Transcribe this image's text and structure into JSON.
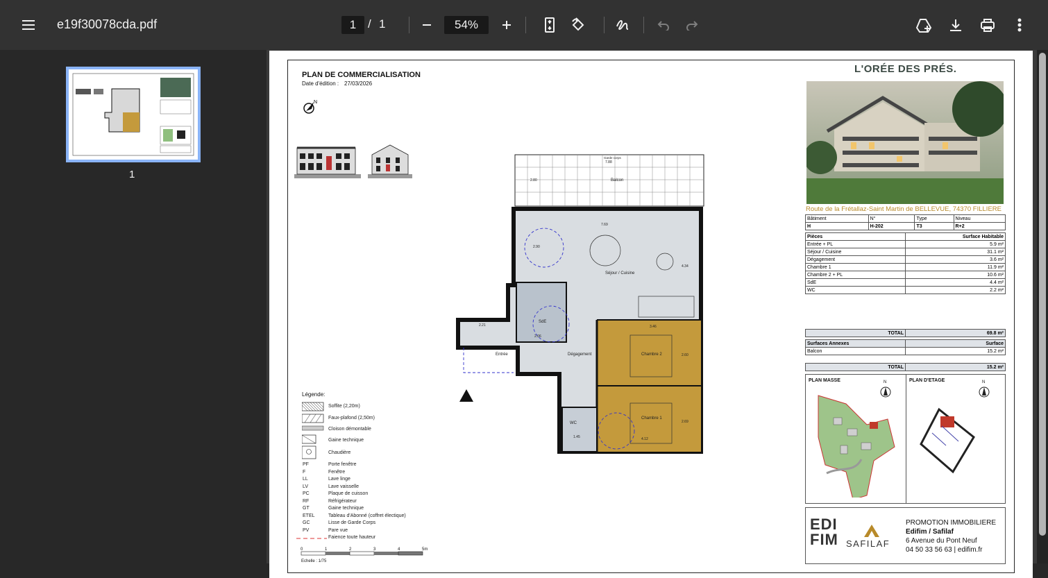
{
  "toolbar": {
    "menu_icon": "menu-icon",
    "filename": "e19f30078cda.pdf",
    "page_current": "1",
    "page_separator": "/",
    "page_total": "1",
    "zoom": "54%"
  },
  "sidebar": {
    "thumb_label": "1"
  },
  "doc": {
    "title": "PLAN DE COMMERCIALISATION",
    "date_label": "Date d'édition :",
    "date_value": "27/03/2026",
    "brand": "L'ORÉE DES PRÉS.",
    "address": "Route de la Frétallaz-Saint Martin de BELLEVUE, 74370 FILLIERE",
    "lot_headers": [
      "Bâtiment",
      "N°",
      "Type",
      "Niveau"
    ],
    "lot_values": [
      "H",
      "H-202",
      "T3",
      "R+2"
    ],
    "rooms_header": [
      "Pièces",
      "Surface Habitable"
    ],
    "rooms": [
      {
        "name": "Entrée + PL",
        "area": "5.9 m²"
      },
      {
        "name": "Séjour / Cuisine",
        "area": "31.1 m²"
      },
      {
        "name": "Dégagement",
        "area": "3.6 m²"
      },
      {
        "name": "Chambre 1",
        "area": "11.9 m²"
      },
      {
        "name": "Chambre 2 + PL",
        "area": "10.6 m²"
      },
      {
        "name": "SdE",
        "area": "4.4 m²"
      },
      {
        "name": "WC",
        "area": "2.2 m²"
      }
    ],
    "total_label": "TOTAL",
    "total_value": "69.8 m²",
    "annex_header": [
      "Surfaces Annexes",
      "Surface"
    ],
    "annex": [
      {
        "name": "Balcon",
        "area": "15.2 m²"
      }
    ],
    "annex_total_label": "TOTAL",
    "annex_total_value": "15.2 m²",
    "plan_masse": "PLAN MASSE",
    "plan_etage": "PLAN D'ETAGE",
    "north": "N",
    "promo_title": "PROMOTION IMMOBILIERE",
    "promo_company": "Edifim / Safilaf",
    "promo_address": "6 Avenue du Pont Neuf",
    "promo_contact": "04 50 33 56 63 | edifim.fr",
    "logo_edifim_1": "EDI",
    "logo_edifim_2": "FIM",
    "logo_safilaf": "SAFILAF",
    "legend_title": "Légende:",
    "legend_hatched": [
      "Soffite (2,20m)",
      "Faux-plafond (2,50m)",
      "Cloison démontable",
      "Gaine technique",
      "Chaudière"
    ],
    "legend_abbr": [
      {
        "k": "PF",
        "v": "Porte fenêtre"
      },
      {
        "k": "F",
        "v": "Fenêtre"
      },
      {
        "k": "LL",
        "v": "Lave linge"
      },
      {
        "k": "LV",
        "v": "Lave vaisselle"
      },
      {
        "k": "PC",
        "v": "Plaque de cuisson"
      },
      {
        "k": "RF",
        "v": "Réfrigérateur"
      },
      {
        "k": "GT",
        "v": "Gaine technique"
      },
      {
        "k": "ETEL",
        "v": "Tableau d'Abonné (coffret électique)"
      },
      {
        "k": "GC",
        "v": "Lisse de Garde Corps"
      },
      {
        "k": "PV",
        "v": "Pare vue"
      },
      {
        "k": "",
        "v": "Faience toute hauteur"
      }
    ],
    "scale_ticks": [
      "0",
      "1",
      "2",
      "3",
      "4",
      "5m"
    ],
    "scale_label": "Echelle : 1/75",
    "plan": {
      "balcon": "Balcon",
      "sejour": "Séjour / Cuisine",
      "sde": "SdE",
      "entree": "Entrée",
      "degagement": "Dégagement",
      "chambre2": "Chambre 2",
      "chambre1": "Chambre 1",
      "wc": "WC",
      "garde_corps": "Garde corps",
      "dims": [
        "7.88",
        "7.69",
        "2.80",
        "3.46",
        "4.12",
        "2.60",
        "2.21",
        "1.45",
        "2.06",
        "2.90",
        "2.69",
        "4.34"
      ]
    }
  }
}
